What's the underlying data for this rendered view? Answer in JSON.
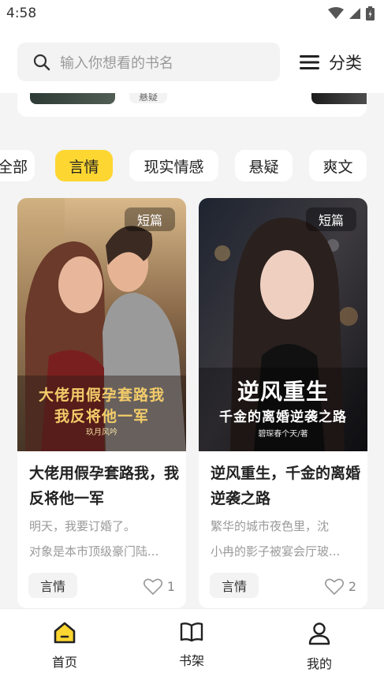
{
  "status_bar": {
    "time": "4:58"
  },
  "search": {
    "placeholder": "输入你想看的书名"
  },
  "category_button": {
    "label": "分类"
  },
  "previous_row": {
    "tag": "悬疑"
  },
  "filters": [
    "全部",
    "言情",
    "现实情感",
    "悬疑",
    "爽文"
  ],
  "active_filter": "言情",
  "accent_color": "#fdd631",
  "books": [
    {
      "badge": "短篇",
      "cover_title_line1": "大佬用假孕套路我",
      "cover_title_line2": "我反将他一军",
      "cover_author": "玖月风吟",
      "title": "大佬用假孕套路我，我反将他一军",
      "desc_line1": "明天，我要订婚了。",
      "desc_line2": "对象是本市顶级豪门陆...",
      "tag": "言情",
      "likes": "1"
    },
    {
      "badge": "短篇",
      "cover_title_line1": "逆风重生",
      "cover_title_line2": "千金的离婚逆袭之路",
      "cover_author": "碧琛春个天/著",
      "title": "逆风重生，千金的离婚逆袭之路",
      "desc_line1": "繁华的城市夜色里，沈",
      "desc_line2": "小冉的影子被宴会厅玻...",
      "tag": "言情",
      "likes": "2"
    }
  ],
  "bottom_nav": [
    {
      "label": "首页",
      "icon": "home-icon",
      "active": true
    },
    {
      "label": "书架",
      "icon": "book-icon",
      "active": false
    },
    {
      "label": "我的",
      "icon": "user-icon",
      "active": false
    }
  ]
}
